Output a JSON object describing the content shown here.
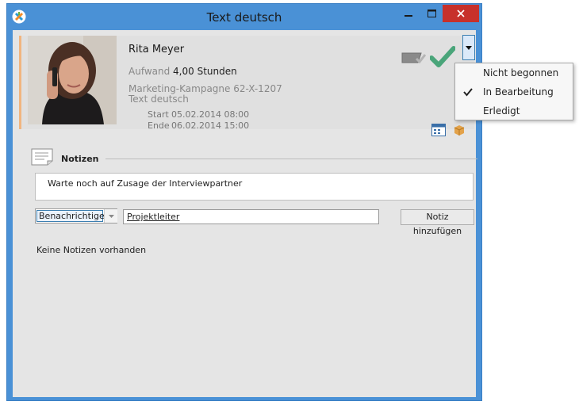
{
  "window": {
    "title": "Text deutsch"
  },
  "task": {
    "assignee": "Rita Meyer",
    "effort_label": "Aufwand",
    "effort_value": "4,00 Stunden",
    "project": "Marketing-Kampagne   62-X-1207",
    "subject": "Text deutsch",
    "start_label": "Start",
    "start_value": "05.02.2014 08:00",
    "end_label": "Ende",
    "end_value": "06.02.2014 15:00"
  },
  "notes": {
    "title": "Notizen",
    "input_value": "Warte noch auf Zusage der Interviewpartner",
    "notify_label": "Benachrichtigen",
    "recipient": "Projektleiter",
    "add_button": "Notiz hinzufügen",
    "empty_text": "Keine Notizen vorhanden"
  },
  "status_menu": {
    "items": [
      {
        "label": "Nicht begonnen",
        "checked": false
      },
      {
        "label": "In Bearbeitung",
        "checked": true
      },
      {
        "label": "Erledigt",
        "checked": false
      }
    ]
  },
  "colors": {
    "titlebar": "#4a91d6",
    "close": "#c7312b",
    "accent_bar": "#f1b57f",
    "check": "#4aa57a"
  },
  "icons": {
    "app": "app-logo-icon",
    "check": "checkmark-icon",
    "eraser": "eraser-icon",
    "calendar": "calendar-icon",
    "box": "package-icon",
    "notes": "notepad-icon"
  }
}
